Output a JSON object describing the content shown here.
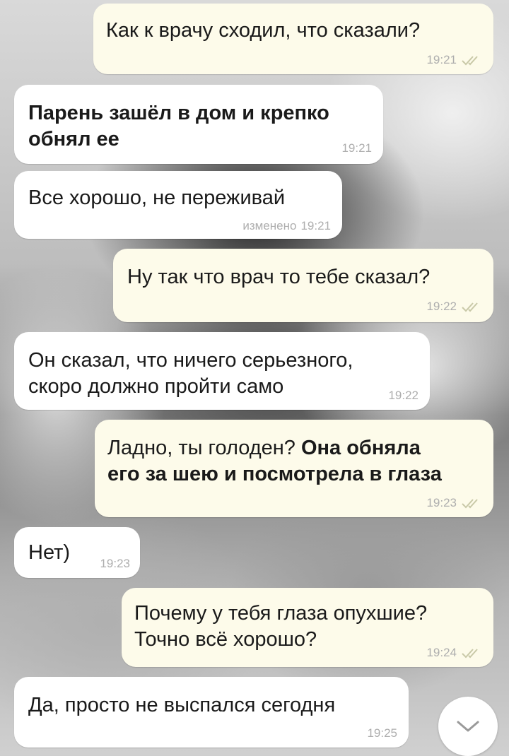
{
  "messages": [
    {
      "dir": "out",
      "parts": [
        {
          "text": "Как к врачу сходил, что сказали?",
          "bold": false
        }
      ],
      "time": "19:21",
      "edited": ""
    },
    {
      "dir": "in",
      "parts": [
        {
          "text": "Парень зашёл в дом и крепко",
          "bold": true
        },
        {
          "text": "обнял ее",
          "bold": true
        }
      ],
      "time": "19:21",
      "edited": ""
    },
    {
      "dir": "in",
      "parts": [
        {
          "text": "Все хорошо, не переживай",
          "bold": false
        }
      ],
      "time": "19:21",
      "edited": "изменено"
    },
    {
      "dir": "out",
      "parts": [
        {
          "text": "Ну так что врач то тебе сказал?",
          "bold": false
        }
      ],
      "time": "19:22",
      "edited": ""
    },
    {
      "dir": "in",
      "parts": [
        {
          "text": "Он сказал, что ничего серьезного,",
          "bold": false
        },
        {
          "text": "скоро должно пройти само",
          "bold": false
        }
      ],
      "time": "19:22",
      "edited": ""
    },
    {
      "dir": "out",
      "line1_plain": "Ладно, ты голоден? ",
      "line1_bold": "Она обняла",
      "line2_bold": "его за шею и посмотрела в глаза",
      "time": "19:23",
      "edited": ""
    },
    {
      "dir": "in",
      "parts": [
        {
          "text": "Нет)",
          "bold": false
        }
      ],
      "time": "19:23",
      "edited": ""
    },
    {
      "dir": "out",
      "parts": [
        {
          "text": "Почему у тебя глаза опухшие?",
          "bold": false
        },
        {
          "text": "Точно всё хорошо?",
          "bold": false
        }
      ],
      "time": "19:24",
      "edited": ""
    },
    {
      "dir": "in",
      "parts": [
        {
          "text": "Да, просто не выспался сегодня",
          "bold": false
        }
      ],
      "time": "19:25",
      "edited": ""
    }
  ],
  "read_tick_color": "#c9c9a8",
  "scroll_button_icon": "chevron-down-icon"
}
